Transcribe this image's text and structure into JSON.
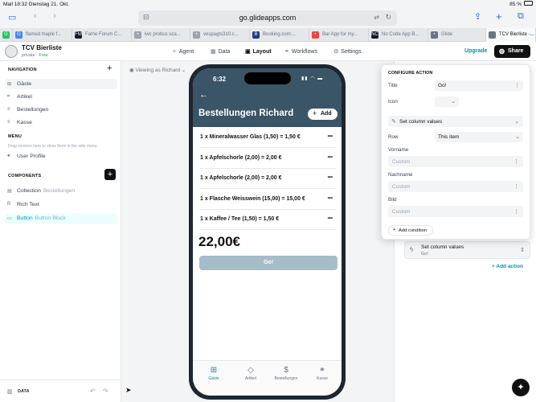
{
  "status_bar": {
    "left": "Mail  18:32  Dienstag 21. Okt.",
    "right": "85 %"
  },
  "browser": {
    "url": "go.glideapps.com",
    "tabs": [
      {
        "icon": "G",
        "color": "#22c55e",
        "label": ""
      },
      {
        "icon": "G",
        "color": "#4285f4",
        "label": "flamed maple f..."
      },
      {
        "icon": "FM",
        "color": "#111827",
        "label": "Fame Forum C..."
      },
      {
        "icon": "•",
        "color": "#9ca3af",
        "label": "iwc probus sca..."
      },
      {
        "icon": "•",
        "color": "#9ca3af",
        "label": "vespagts310.c..."
      },
      {
        "icon": "B",
        "color": "#1e3a8a",
        "label": "Booking.com:..."
      },
      {
        "icon": "•",
        "color": "#ef4444",
        "label": "Bar App for my..."
      },
      {
        "icon": "NC",
        "color": "#111827",
        "label": "No Code App B..."
      },
      {
        "icon": "•",
        "color": "#6b7280",
        "label": "Glide"
      },
      {
        "icon": "",
        "color": "#6b7280",
        "label": "TCV Bierliste -..."
      }
    ]
  },
  "app": {
    "name": "TCV Bierliste",
    "privacy": "private",
    "plan": "Free",
    "nav_tabs": [
      "Agent",
      "Data",
      "Layout",
      "Workflows",
      "Settings"
    ],
    "upgrade": "Upgrade",
    "share": "Share"
  },
  "sidebar": {
    "navigation_title": "NAVIGATION",
    "nav_items": [
      "Gäste",
      "Artikel",
      "Bestellungen",
      "Kasse"
    ],
    "menu_title": "MENU",
    "menu_hint": "Drag screens here to show them in the side menu.",
    "menu_item": "User Profile",
    "components_title": "COMPONENTS",
    "components": [
      {
        "name": "Collection",
        "sub": "Bestellungen"
      },
      {
        "name": "Rich Text",
        "sub": ""
      },
      {
        "name": "Button",
        "sub": "Button Block"
      }
    ],
    "data_label": "DATA"
  },
  "preview": {
    "viewing_as": "Viewing as Richard",
    "time": "6:32",
    "title": "Bestellungen Richard",
    "add_label": "Add",
    "rows": [
      "1 x Mineralwasser Glas (1,50) = 1,50 €",
      "1 x Apfelschorle (2,00) = 2,00 €",
      "1 x Apfelschorle (2,00) = 2,00 €",
      "1 x Flasche Weisswein (15,00) = 15,00 €",
      "1 x Kaffee / Tee (1,50) = 1,50 €"
    ],
    "total": "22,00€",
    "button": "Go!",
    "bottom_nav": [
      "Gäste",
      "Artikel",
      "Bestellungen",
      "Kasse"
    ]
  },
  "configure": {
    "heading": "CONFIGURE ACTION",
    "title_label": "Title",
    "title_value": "Go!",
    "icon_label": "Icon",
    "action": "Set column values",
    "row_label": "Row",
    "row_value": "This item",
    "vorname": "Vorname",
    "nachname": "Nachname",
    "bild": "Bild",
    "placeholder": "Custom",
    "add_condition": "Add condition"
  },
  "rightpanel": {
    "action_title": "Set column values",
    "action_sub": "Go!",
    "add_action": "Add action"
  }
}
